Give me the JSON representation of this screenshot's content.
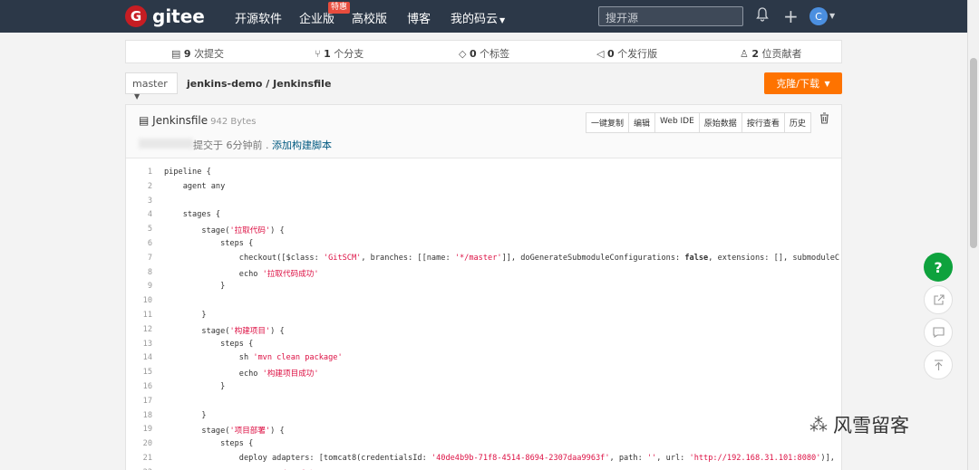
{
  "nav": {
    "logo_letter": "G",
    "logo_text": "gitee",
    "items": [
      "开源软件",
      "企业版",
      "高校版",
      "博客",
      "我的码云"
    ],
    "hot_badge": "特惠",
    "search_placeholder": "搜开源",
    "avatar_letter": "C"
  },
  "stats": {
    "commits": "9",
    "commits_label": "次提交",
    "branches": "1",
    "branches_label": "个分支",
    "tags": "0",
    "tags_label": "个标签",
    "releases": "0",
    "releases_label": "个发行版",
    "contributors": "2",
    "contributors_label": "位贡献者"
  },
  "branch": "master",
  "breadcrumb": {
    "repo": "jenkins-demo",
    "sep": "/",
    "file": "Jenkinsfile"
  },
  "clone_label": "克隆/下载",
  "file": {
    "name": "Jenkinsfile",
    "size": "942 Bytes",
    "commit_prefix": "提交于 6分钟前 .",
    "commit_msg": "添加构建脚本",
    "buttons": [
      "一键复制",
      "编辑",
      "Web IDE",
      "原始数据",
      "按行查看",
      "历史"
    ]
  },
  "code_lines": [
    {
      "n": "1",
      "html": "pipeline {"
    },
    {
      "n": "2",
      "html": "    agent any"
    },
    {
      "n": "3",
      "html": ""
    },
    {
      "n": "4",
      "html": "    stages {"
    },
    {
      "n": "5",
      "html": "        stage(<span class='str'>'拉取代码'</span>) {"
    },
    {
      "n": "6",
      "html": "            steps {"
    },
    {
      "n": "7",
      "html": "                checkout([$class: <span class='str'>'GitSCM'</span>, branches: [[name: <span class='str'>'*/master'</span>]], doGenerateSubmoduleConfigurations: <span class='kw'>false</span>, extensions: [], submoduleC"
    },
    {
      "n": "8",
      "html": "                echo <span class='str'>'拉取代码成功'</span>"
    },
    {
      "n": "9",
      "html": "            }"
    },
    {
      "n": "10",
      "html": ""
    },
    {
      "n": "11",
      "html": "        }"
    },
    {
      "n": "12",
      "html": "        stage(<span class='str'>'构建项目'</span>) {"
    },
    {
      "n": "13",
      "html": "            steps {"
    },
    {
      "n": "14",
      "html": "                sh <span class='str'>'mvn clean package'</span>"
    },
    {
      "n": "15",
      "html": "                echo <span class='str'>'构建项目成功'</span>"
    },
    {
      "n": "16",
      "html": "            }"
    },
    {
      "n": "17",
      "html": ""
    },
    {
      "n": "18",
      "html": "        }"
    },
    {
      "n": "19",
      "html": "        stage(<span class='str'>'项目部署'</span>) {"
    },
    {
      "n": "20",
      "html": "            steps {"
    },
    {
      "n": "21",
      "html": "                deploy adapters: [tomcat8(credentialsId: <span class='str'>'40de4b9b-71f8-4514-8694-2307daa9963f'</span>, path: <span class='str'>''</span>, url: <span class='str'>'http://192.168.31.101:8080'</span>)],"
    },
    {
      "n": "22",
      "html": "                echo <span class='str'>'项目部署成功'</span>"
    }
  ],
  "side": {
    "help": "?"
  },
  "watermark": "风雪留客"
}
